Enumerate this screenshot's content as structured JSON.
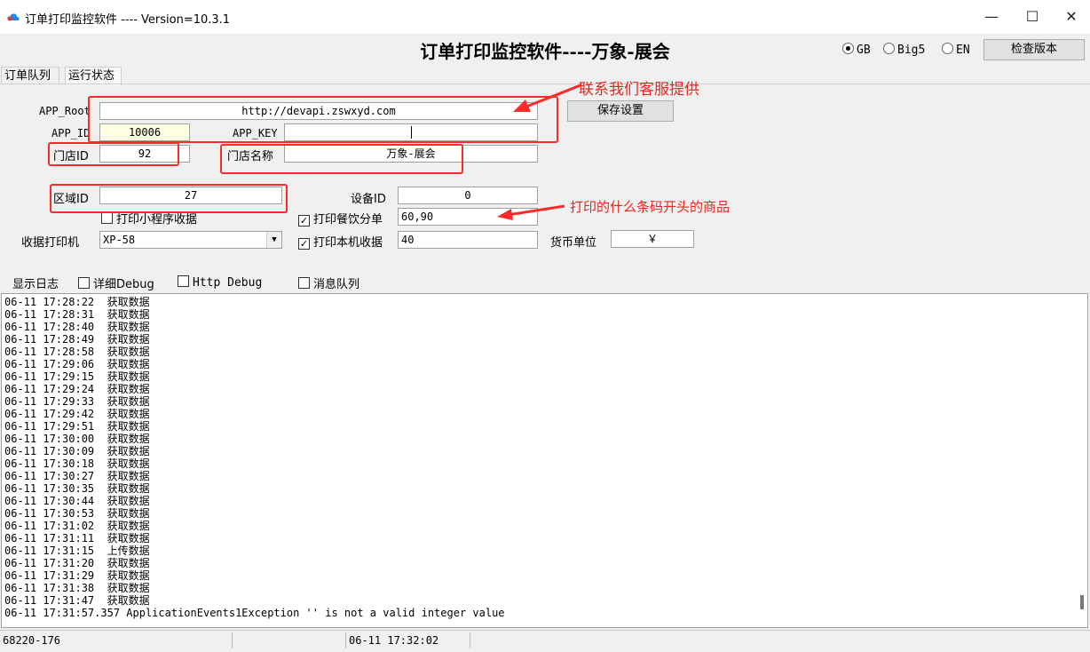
{
  "window": {
    "title": "订单打印监控软件 ----  Version=10.3.1",
    "minimize": "—",
    "maximize": "☐",
    "close": "✕"
  },
  "header": {
    "title": "订单打印监控软件----万象-展会",
    "languages": [
      {
        "label": "GB",
        "selected": true
      },
      {
        "label": "Big5",
        "selected": false
      },
      {
        "label": "EN",
        "selected": false
      }
    ],
    "check_version": "检查版本"
  },
  "tabs": [
    {
      "label": "订单队列",
      "active": false
    },
    {
      "label": "运行状态",
      "active": true
    }
  ],
  "settings": {
    "app_root_label": "APP_Root",
    "app_root_value": "http://devapi.zswxyd.com",
    "save_label": "保存设置",
    "app_id_label": "APP_ID",
    "app_id_value": "10006",
    "app_key_label": "APP_KEY",
    "app_key_value": "",
    "store_id_label": "门店ID",
    "store_id_value": "92",
    "store_name_label": "门店名称",
    "store_name_value": "万象-展会",
    "area_id_label": "区域ID",
    "area_id_value": "27",
    "device_id_label": "设备ID",
    "device_id_value": "0",
    "print_mini_label": "打印小程序收据",
    "print_mini_checked": false,
    "print_split_label": "打印餐饮分单",
    "print_split_checked": true,
    "print_split_value": "60,90",
    "printer_label": "收据打印机",
    "printer_value": "XP-58",
    "print_local_label": "打印本机收据",
    "print_local_checked": true,
    "print_local_value": "40",
    "currency_label": "货币单位",
    "currency_value": "￥"
  },
  "annotations": {
    "contact": "联系我们客服提供",
    "barcode": "打印的什么条码开头的商品"
  },
  "log_options": {
    "show_log": "显示日志",
    "detail_debug": "详细Debug",
    "http_debug": "Http Debug",
    "message_queue": "消息队列"
  },
  "log_lines": [
    "06-11 17:28:22  获取数据",
    "06-11 17:28:31  获取数据",
    "06-11 17:28:40  获取数据",
    "06-11 17:28:49  获取数据",
    "06-11 17:28:58  获取数据",
    "06-11 17:29:06  获取数据",
    "06-11 17:29:15  获取数据",
    "06-11 17:29:24  获取数据",
    "06-11 17:29:33  获取数据",
    "06-11 17:29:42  获取数据",
    "06-11 17:29:51  获取数据",
    "06-11 17:30:00  获取数据",
    "06-11 17:30:09  获取数据",
    "06-11 17:30:18  获取数据",
    "06-11 17:30:27  获取数据",
    "06-11 17:30:35  获取数据",
    "06-11 17:30:44  获取数据",
    "06-11 17:30:53  获取数据",
    "06-11 17:31:02  获取数据",
    "06-11 17:31:11  获取数据",
    "06-11 17:31:15  上传数据",
    "06-11 17:31:20  获取数据",
    "06-11 17:31:29  获取数据",
    "06-11 17:31:38  获取数据",
    "06-11 17:31:47  获取数据",
    "06-11 17:31:57.357 ApplicationEvents1Exception '' is not a valid integer value"
  ],
  "status": {
    "left": "68220-176",
    "middle": "",
    "time": "06-11 17:32:02"
  },
  "colors": {
    "annotation_red": "#ff2a2a"
  }
}
